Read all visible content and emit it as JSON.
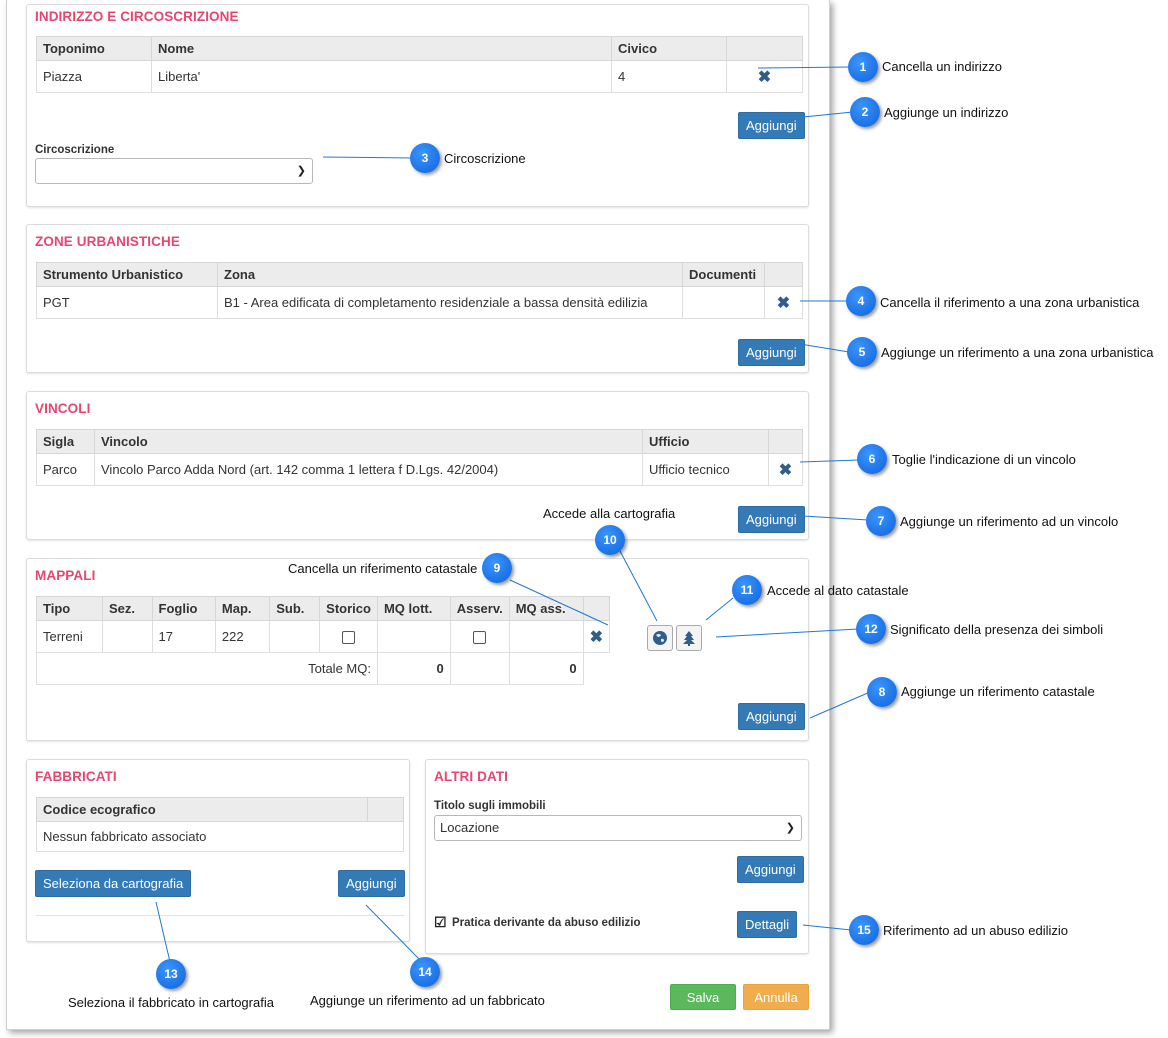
{
  "indirizzo": {
    "title": "INDIRIZZO E CIRCOSCRIZIONE",
    "columns": [
      "Toponimo",
      "Nome",
      "Civico"
    ],
    "row": {
      "toponimo": "Piazza",
      "nome": "Liberta'",
      "civico": "4"
    },
    "add_label": "Aggiungi",
    "circoscrizione_label": "Circoscrizione",
    "circoscrizione_value": ""
  },
  "zone": {
    "title": "ZONE URBANISTICHE",
    "columns": [
      "Strumento Urbanistico",
      "Zona",
      "Documenti"
    ],
    "row": {
      "strumento": "PGT",
      "zona": "B1 - Area edificata di completamento residenziale a bassa densità edilizia",
      "documenti": ""
    },
    "add_label": "Aggiungi"
  },
  "vincoli": {
    "title": "VINCOLI",
    "columns": [
      "Sigla",
      "Vincolo",
      "Ufficio"
    ],
    "row": {
      "sigla": "Parco",
      "vincolo": "Vincolo Parco Adda Nord (art. 142 comma 1 lettera f D.Lgs. 42/2004)",
      "ufficio": "Ufficio tecnico"
    },
    "add_label": "Aggiungi"
  },
  "mappali": {
    "title": "MAPPALI",
    "columns": [
      "Tipo",
      "Sez.",
      "Foglio",
      "Map.",
      "Sub.",
      "Storico",
      "MQ lott.",
      "Asserv.",
      "MQ ass."
    ],
    "row": {
      "tipo": "Terreni",
      "sez": "",
      "foglio": "17",
      "map": "222",
      "sub": "",
      "storico": false,
      "mq_lott": "",
      "asserv": false,
      "mq_ass": ""
    },
    "totale_label": "Totale MQ:",
    "totale_lott": "0",
    "totale_ass": "0",
    "add_label": "Aggiungi"
  },
  "fabbricati": {
    "title": "FABBRICATI",
    "column": "Codice ecografico",
    "empty_text": "Nessun fabbricato associato",
    "select_map_label": "Seleziona da cartografia",
    "add_label": "Aggiungi"
  },
  "altri": {
    "title": "ALTRI DATI",
    "titolo_label": "Titolo sugli immobili",
    "titolo_value": "Locazione",
    "add_label": "Aggiungi",
    "abuso_label": "Pratica derivante da abuso edilizio",
    "abuso_checked": true,
    "dettagli_label": "Dettagli"
  },
  "footer": {
    "save_label": "Salva",
    "cancel_label": "Annulla"
  },
  "callouts": [
    {
      "n": "1",
      "text": "Cancella un indirizzo"
    },
    {
      "n": "2",
      "text": "Aggiunge un indirizzo"
    },
    {
      "n": "3",
      "text": "Circoscrizione"
    },
    {
      "n": "4",
      "text": "Cancella il riferimento a una zona urbanistica"
    },
    {
      "n": "5",
      "text": "Aggiunge un riferimento a una zona urbanistica"
    },
    {
      "n": "6",
      "text": "Toglie l'indicazione di un vincolo"
    },
    {
      "n": "7",
      "text": "Aggiunge un riferimento ad un vincolo"
    },
    {
      "n": "8",
      "text": "Aggiunge un riferimento catastale"
    },
    {
      "n": "9",
      "text": "Cancella un riferimento catastale"
    },
    {
      "n": "10",
      "text": "Accede alla cartografia"
    },
    {
      "n": "11",
      "text": "Accede al dato catastale"
    },
    {
      "n": "12",
      "text": "Significato della presenza dei simboli"
    },
    {
      "n": "13",
      "text": "Seleziona il fabbricato in cartografia"
    },
    {
      "n": "14",
      "text": "Aggiunge un riferimento ad un fabbricato"
    },
    {
      "n": "15",
      "text": "Riferimento ad un abuso edilizio"
    }
  ],
  "colors": {
    "accent_title": "#e8456f",
    "primary": "#337ab7",
    "success": "#5cb85c",
    "warning": "#f0ad4e",
    "badge": "#0b63d8"
  },
  "icons": {
    "delete": "x-icon",
    "map": "globe-icon",
    "cadastre": "tree-icon",
    "dropdown": "chevron-down-icon"
  }
}
